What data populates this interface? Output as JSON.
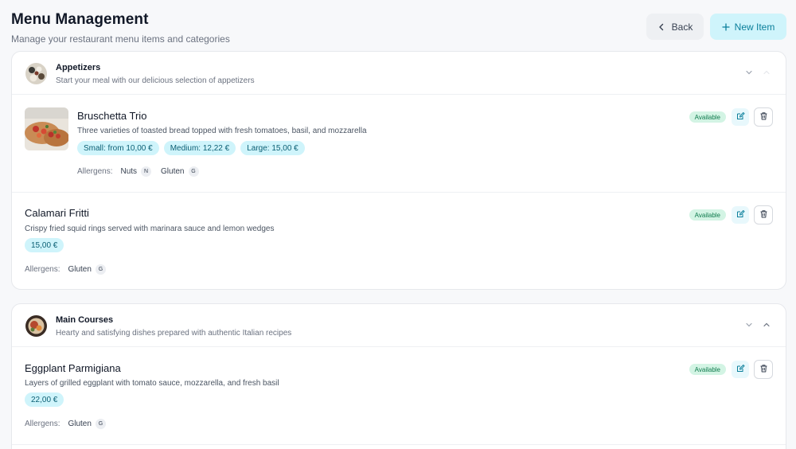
{
  "header": {
    "title": "Menu Management",
    "subtitle": "Manage your restaurant menu items and categories",
    "back_label": "Back",
    "new_label": "New Item"
  },
  "categories": [
    {
      "name": "Appetizers",
      "description": "Start your meal with our delicious selection of appetizers",
      "items": [
        {
          "name": "Bruschetta Trio",
          "description": "Three varieties of toasted bread topped with fresh tomatoes, basil, and mozzarella",
          "prices": [
            "Small: from 10,00 €",
            "Medium: 12,22 €",
            "Large: 15,00 €"
          ],
          "allergens_label": "Allergens:",
          "allergens": [
            {
              "name": "Nuts",
              "code": "N"
            },
            {
              "name": "Gluten",
              "code": "G"
            }
          ],
          "status": "Available"
        },
        {
          "name": "Calamari Fritti",
          "description": "Crispy fried squid rings served with marinara sauce and lemon wedges",
          "prices": [
            "15,00 €"
          ],
          "allergens_label": "Allergens:",
          "allergens": [
            {
              "name": "Gluten",
              "code": "G"
            }
          ],
          "status": "Available"
        }
      ]
    },
    {
      "name": "Main Courses",
      "description": "Hearty and satisfying dishes prepared with authentic Italian recipes",
      "items": [
        {
          "name": "Eggplant Parmigiana",
          "description": "Layers of grilled eggplant with tomato sauce, mozzarella, and fresh basil",
          "prices": [
            "22,00 €"
          ],
          "allergens_label": "Allergens:",
          "allergens": [
            {
              "name": "Gluten",
              "code": "G"
            }
          ],
          "status": "Available"
        }
      ]
    }
  ],
  "icons": {
    "back": "chevron-left-icon",
    "new": "plus-icon",
    "collapse": "chevron-down-icon",
    "expand": "chevron-up-icon",
    "edit": "edit-icon",
    "delete": "trash-icon"
  },
  "colors": {
    "accent": "#0b7f9b",
    "accent_bg": "#cff4fb",
    "available_bg": "#d3f4e4",
    "available_text": "#0f7a4d"
  }
}
